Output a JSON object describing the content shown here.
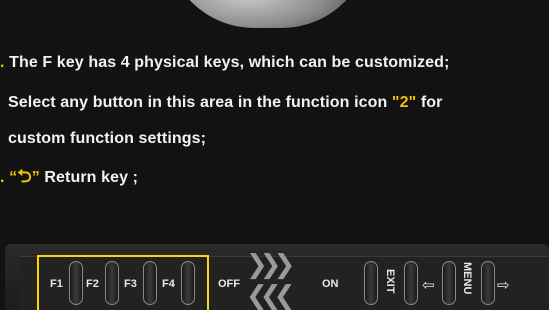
{
  "instructions": {
    "line1": "The F key has 4 physical keys, which can be customized;",
    "line2_pre": "Select any button in this area in the function icon ",
    "line2_hl": "\"2\"",
    "line2_post": " for",
    "line3": "custom function settings;",
    "line4_open": "“",
    "line4_glyph": "⮌",
    "line4_close": "”",
    "line4_text": "Return key ;",
    "bullet": "."
  },
  "device": {
    "f1": "F1",
    "f2": "F2",
    "f3": "F3",
    "f4": "F4",
    "off": "OFF",
    "on": "ON",
    "exit": "EXIT",
    "menu": "MENU",
    "switch_glyph": "❯❯❯ ❮❮❮",
    "left_arrow": "⇦",
    "right_arrow": "⇨"
  },
  "colors": {
    "accent": "#f2c200",
    "highlight_box": "#ffd400"
  }
}
